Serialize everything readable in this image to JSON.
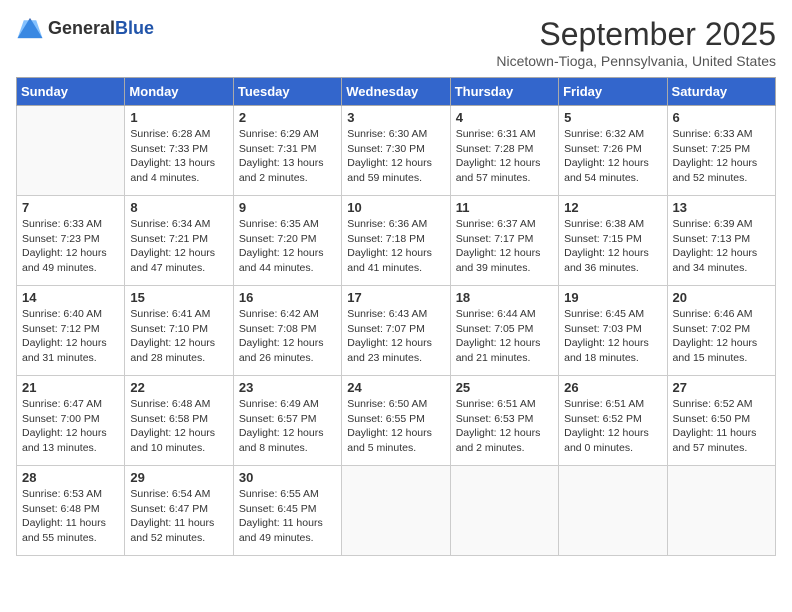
{
  "header": {
    "logo_general": "General",
    "logo_blue": "Blue",
    "title": "September 2025",
    "subtitle": "Nicetown-Tioga, Pennsylvania, United States"
  },
  "days_of_week": [
    "Sunday",
    "Monday",
    "Tuesday",
    "Wednesday",
    "Thursday",
    "Friday",
    "Saturday"
  ],
  "weeks": [
    [
      {
        "day": "",
        "info": ""
      },
      {
        "day": "1",
        "info": "Sunrise: 6:28 AM\nSunset: 7:33 PM\nDaylight: 13 hours\nand 4 minutes."
      },
      {
        "day": "2",
        "info": "Sunrise: 6:29 AM\nSunset: 7:31 PM\nDaylight: 13 hours\nand 2 minutes."
      },
      {
        "day": "3",
        "info": "Sunrise: 6:30 AM\nSunset: 7:30 PM\nDaylight: 12 hours\nand 59 minutes."
      },
      {
        "day": "4",
        "info": "Sunrise: 6:31 AM\nSunset: 7:28 PM\nDaylight: 12 hours\nand 57 minutes."
      },
      {
        "day": "5",
        "info": "Sunrise: 6:32 AM\nSunset: 7:26 PM\nDaylight: 12 hours\nand 54 minutes."
      },
      {
        "day": "6",
        "info": "Sunrise: 6:33 AM\nSunset: 7:25 PM\nDaylight: 12 hours\nand 52 minutes."
      }
    ],
    [
      {
        "day": "7",
        "info": "Sunrise: 6:33 AM\nSunset: 7:23 PM\nDaylight: 12 hours\nand 49 minutes."
      },
      {
        "day": "8",
        "info": "Sunrise: 6:34 AM\nSunset: 7:21 PM\nDaylight: 12 hours\nand 47 minutes."
      },
      {
        "day": "9",
        "info": "Sunrise: 6:35 AM\nSunset: 7:20 PM\nDaylight: 12 hours\nand 44 minutes."
      },
      {
        "day": "10",
        "info": "Sunrise: 6:36 AM\nSunset: 7:18 PM\nDaylight: 12 hours\nand 41 minutes."
      },
      {
        "day": "11",
        "info": "Sunrise: 6:37 AM\nSunset: 7:17 PM\nDaylight: 12 hours\nand 39 minutes."
      },
      {
        "day": "12",
        "info": "Sunrise: 6:38 AM\nSunset: 7:15 PM\nDaylight: 12 hours\nand 36 minutes."
      },
      {
        "day": "13",
        "info": "Sunrise: 6:39 AM\nSunset: 7:13 PM\nDaylight: 12 hours\nand 34 minutes."
      }
    ],
    [
      {
        "day": "14",
        "info": "Sunrise: 6:40 AM\nSunset: 7:12 PM\nDaylight: 12 hours\nand 31 minutes."
      },
      {
        "day": "15",
        "info": "Sunrise: 6:41 AM\nSunset: 7:10 PM\nDaylight: 12 hours\nand 28 minutes."
      },
      {
        "day": "16",
        "info": "Sunrise: 6:42 AM\nSunset: 7:08 PM\nDaylight: 12 hours\nand 26 minutes."
      },
      {
        "day": "17",
        "info": "Sunrise: 6:43 AM\nSunset: 7:07 PM\nDaylight: 12 hours\nand 23 minutes."
      },
      {
        "day": "18",
        "info": "Sunrise: 6:44 AM\nSunset: 7:05 PM\nDaylight: 12 hours\nand 21 minutes."
      },
      {
        "day": "19",
        "info": "Sunrise: 6:45 AM\nSunset: 7:03 PM\nDaylight: 12 hours\nand 18 minutes."
      },
      {
        "day": "20",
        "info": "Sunrise: 6:46 AM\nSunset: 7:02 PM\nDaylight: 12 hours\nand 15 minutes."
      }
    ],
    [
      {
        "day": "21",
        "info": "Sunrise: 6:47 AM\nSunset: 7:00 PM\nDaylight: 12 hours\nand 13 minutes."
      },
      {
        "day": "22",
        "info": "Sunrise: 6:48 AM\nSunset: 6:58 PM\nDaylight: 12 hours\nand 10 minutes."
      },
      {
        "day": "23",
        "info": "Sunrise: 6:49 AM\nSunset: 6:57 PM\nDaylight: 12 hours\nand 8 minutes."
      },
      {
        "day": "24",
        "info": "Sunrise: 6:50 AM\nSunset: 6:55 PM\nDaylight: 12 hours\nand 5 minutes."
      },
      {
        "day": "25",
        "info": "Sunrise: 6:51 AM\nSunset: 6:53 PM\nDaylight: 12 hours\nand 2 minutes."
      },
      {
        "day": "26",
        "info": "Sunrise: 6:51 AM\nSunset: 6:52 PM\nDaylight: 12 hours\nand 0 minutes."
      },
      {
        "day": "27",
        "info": "Sunrise: 6:52 AM\nSunset: 6:50 PM\nDaylight: 11 hours\nand 57 minutes."
      }
    ],
    [
      {
        "day": "28",
        "info": "Sunrise: 6:53 AM\nSunset: 6:48 PM\nDaylight: 11 hours\nand 55 minutes."
      },
      {
        "day": "29",
        "info": "Sunrise: 6:54 AM\nSunset: 6:47 PM\nDaylight: 11 hours\nand 52 minutes."
      },
      {
        "day": "30",
        "info": "Sunrise: 6:55 AM\nSunset: 6:45 PM\nDaylight: 11 hours\nand 49 minutes."
      },
      {
        "day": "",
        "info": ""
      },
      {
        "day": "",
        "info": ""
      },
      {
        "day": "",
        "info": ""
      },
      {
        "day": "",
        "info": ""
      }
    ]
  ]
}
